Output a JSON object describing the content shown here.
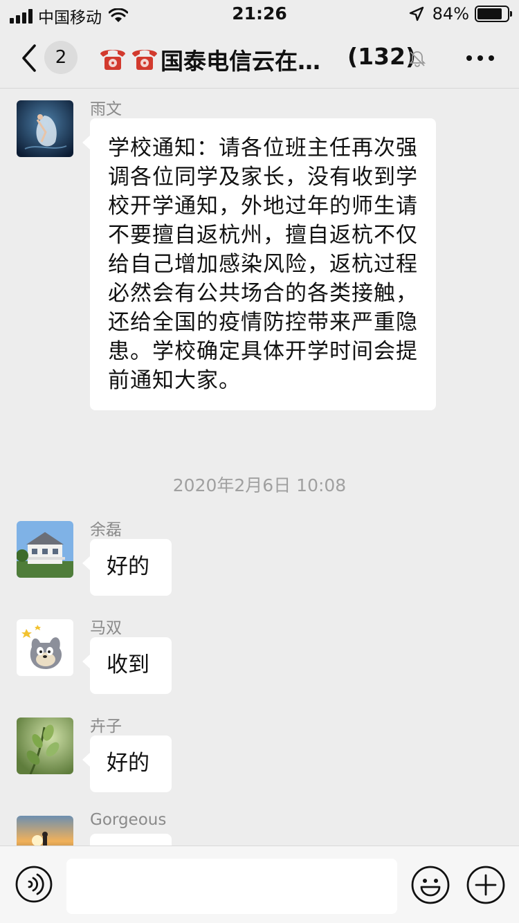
{
  "status_bar": {
    "carrier": "中国移动",
    "time": "21:26",
    "battery_percent": "84%",
    "battery_level": 0.84
  },
  "nav": {
    "unread_count": "2",
    "title": "国泰电信云在…",
    "member_count": "(132)",
    "icons": [
      "back-chevron-icon",
      "telephone-icon",
      "bell-muted-icon",
      "more-dots-icon"
    ]
  },
  "messages": [
    {
      "sender": "雨文",
      "text": "学校通知：请各位班主任再次强调各位同学及家长，没有收到学校开学通知，外地过年的师生请不要擅自返杭州，擅自返杭不仅给自己增加感染风险，返杭过程必然会有公共场合的各类接触，还给全国的疫情防控带来严重隐患。学校确定具体开学时间会提前通知大家。",
      "avatar_icon": "dancer-photo-avatar"
    },
    {
      "sender": "余磊",
      "text": "好的",
      "avatar_icon": "house-photo-avatar"
    },
    {
      "sender": "马双",
      "text": "收到",
      "avatar_icon": "cartoon-cat-avatar"
    },
    {
      "sender": "卉子",
      "text": "好的",
      "avatar_icon": "plant-photo-avatar"
    },
    {
      "sender": "Gorgeous",
      "text": "",
      "avatar_icon": "sunset-photo-avatar"
    }
  ],
  "timestamp": "2020年2月6日 10:08",
  "input_bar": {
    "placeholder": "",
    "icons": [
      "voice-icon",
      "emoji-icon",
      "plus-icon"
    ]
  },
  "colors": {
    "background": "#ededed",
    "bubble": "#ffffff",
    "meta_text": "#8a8a8a"
  }
}
